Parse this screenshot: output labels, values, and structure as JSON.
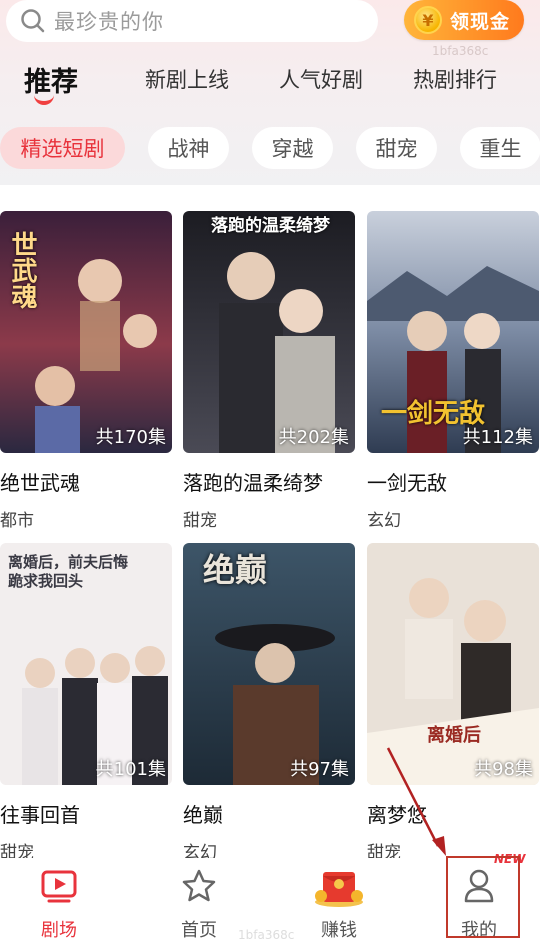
{
  "search": {
    "placeholder": "最珍贵的你"
  },
  "cash_button": {
    "label": "领现金",
    "coin_symbol": "¥"
  },
  "watermark": "1bfa368c",
  "tabs": [
    {
      "label": "推荐",
      "active": true
    },
    {
      "label": "新剧上线",
      "active": false
    },
    {
      "label": "人气好剧",
      "active": false
    },
    {
      "label": "热剧排行",
      "active": false
    }
  ],
  "chips": [
    {
      "label": "精选短剧",
      "active": true
    },
    {
      "label": "战神",
      "active": false
    },
    {
      "label": "穿越",
      "active": false
    },
    {
      "label": "甜宠",
      "active": false
    },
    {
      "label": "重生",
      "active": false
    }
  ],
  "dramas": [
    {
      "title": "绝世武魂",
      "genre": "都市",
      "episodes": "共170集",
      "poster_text": "世武魂",
      "palette": [
        "#3a1f3a",
        "#8c3a4a",
        "#c9a27a"
      ]
    },
    {
      "title": "落跑的温柔绮梦",
      "genre": "甜宠",
      "episodes": "共202集",
      "poster_text": "落跑的温柔绮梦",
      "palette": [
        "#1c1c22",
        "#4a4a55",
        "#b9b6b0"
      ]
    },
    {
      "title": "一剑无敌",
      "genre": "玄幻",
      "episodes": "共112集",
      "poster_text": "一剑无敌",
      "palette": [
        "#2f3c52",
        "#7b8aa3",
        "#c9d0dc"
      ]
    },
    {
      "title": "往事回首",
      "genre": "甜宠",
      "episodes": "共101集",
      "poster_text": "离婚后，前夫后悔跪求我回头",
      "palette": [
        "#f2eeee",
        "#d8cfd0",
        "#3a3a44"
      ]
    },
    {
      "title": "绝巅",
      "genre": "玄幻",
      "episodes": "共97集",
      "poster_text": "绝巅",
      "palette": [
        "#1d2a36",
        "#3d5568",
        "#7d5a40"
      ]
    },
    {
      "title": "离梦悠",
      "genre": "甜宠",
      "episodes": "共98集",
      "poster_text": "离婚后",
      "palette": [
        "#e9e1d8",
        "#b89a80",
        "#3a2e2a"
      ]
    }
  ],
  "nav": [
    {
      "label": "剧场",
      "icon": "tv-play-icon",
      "active": true
    },
    {
      "label": "首页",
      "icon": "star-icon",
      "active": false
    },
    {
      "label": "赚钱",
      "icon": "red-envelope-icon",
      "active": false
    },
    {
      "label": "我的",
      "icon": "user-icon",
      "active": false
    }
  ],
  "new_badge": "NEW",
  "colors": {
    "accent": "#e8333c",
    "chip_active_bg": "#fbd9da"
  }
}
